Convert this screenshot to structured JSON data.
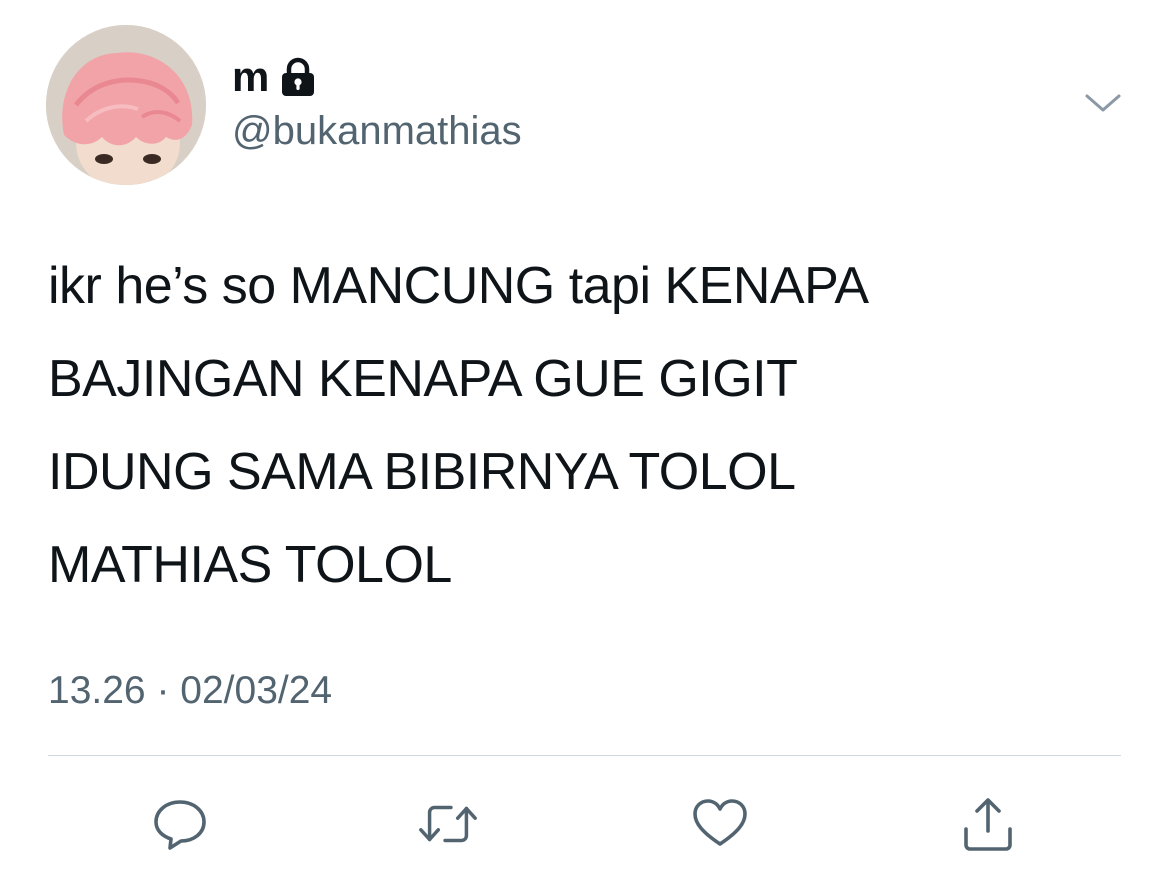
{
  "user": {
    "display_name": "m",
    "protected_icon": "lock-icon",
    "handle": "@bukanmathias",
    "avatar": "pink-haired-person-photo"
  },
  "tweet": {
    "text": "ikr he’s so MANCUNG tapi KENAPA\nBAJINGAN KENAPA GUE GIGIT\nIDUNG SAMA BIBIRNYA TOLOL\nMATHIAS TOLOL",
    "time": "13.26",
    "separator": "·",
    "date": "02/03/24"
  },
  "menu": {
    "icon": "chevron-down-icon"
  },
  "actions": [
    {
      "name": "reply",
      "icon": "speech-bubble-icon"
    },
    {
      "name": "retweet",
      "icon": "retweet-icon"
    },
    {
      "name": "like",
      "icon": "heart-icon"
    },
    {
      "name": "share",
      "icon": "share-upload-icon"
    }
  ],
  "colors": {
    "text": "#0f1419",
    "secondary": "#536471",
    "divider": "#cfd9de",
    "avatar_hair": "#f2a3a8"
  }
}
